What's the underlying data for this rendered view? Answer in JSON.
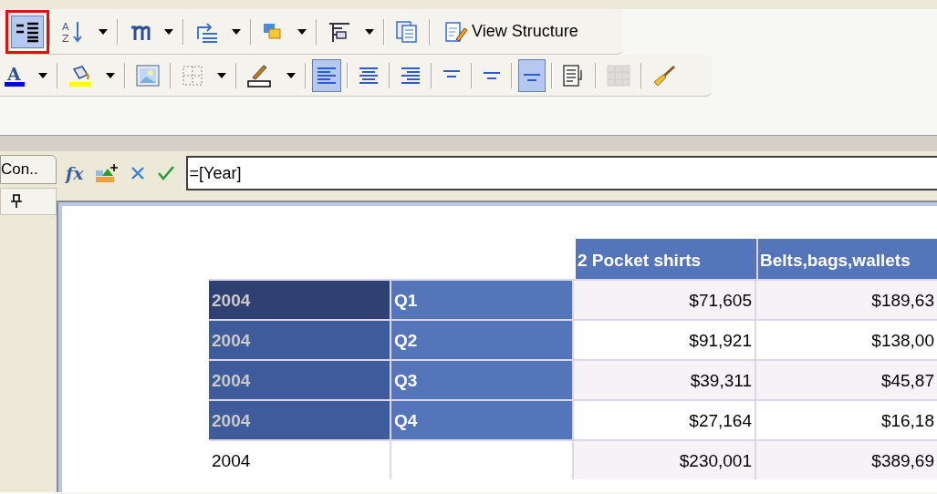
{
  "toolbars": [
    {
      "items": [
        {
          "selected": true,
          "highlighted": true,
          "dropdown": false
        },
        {
          "selected": false,
          "dropdown": true,
          "glyphs": [
            "A",
            "Z"
          ]
        },
        {
          "selected": false,
          "dropdown": true
        },
        {
          "selected": false,
          "dropdown": true
        },
        {
          "selected": false,
          "dropdown": true
        },
        {
          "selected": false,
          "dropdown": true
        },
        {
          "selected": false,
          "dropdown": false
        },
        {
          "selected": false,
          "dropdown": false,
          "label": "View Structure"
        }
      ]
    },
    {
      "items": [
        {
          "selected": false,
          "dropdown": true,
          "glyphs": [
            "A"
          ]
        },
        {
          "selected": false,
          "dropdown": true
        },
        {
          "selected": false,
          "dropdown": false
        },
        {
          "selected": false,
          "dropdown": true
        },
        {
          "selected": false,
          "dropdown": true
        },
        {
          "selected": true,
          "dropdown": false
        },
        {
          "selected": false,
          "dropdown": false
        },
        {
          "selected": false,
          "dropdown": false
        },
        {
          "selected": false,
          "dropdown": false
        },
        {
          "selected": false,
          "dropdown": false
        },
        {
          "selected": true,
          "dropdown": false
        },
        {
          "selected": false,
          "dropdown": false
        },
        {
          "selected": false,
          "dropdown": false,
          "disabled": true
        },
        {
          "selected": false,
          "dropdown": false
        }
      ]
    }
  ],
  "side_panel": {
    "tab": "Con.."
  },
  "formula_bar": {
    "function_label": "fx",
    "value": "=[Year]"
  },
  "table": {
    "columns": [
      "2 Pocket shirts",
      "Belts,bags,wallets"
    ],
    "rows": [
      {
        "kind": "quarter",
        "selected": true,
        "year": "2004",
        "quarter": "Q1",
        "values": [
          "$71,605",
          "$189,63"
        ]
      },
      {
        "kind": "quarter",
        "selected": false,
        "year": "2004",
        "quarter": "Q2",
        "values": [
          "$91,921",
          "$138,00"
        ]
      },
      {
        "kind": "quarter",
        "selected": false,
        "year": "2004",
        "quarter": "Q3",
        "values": [
          "$39,311",
          "$45,87"
        ]
      },
      {
        "kind": "quarter",
        "selected": false,
        "year": "2004",
        "quarter": "Q4",
        "values": [
          "$27,164",
          "$16,18"
        ]
      },
      {
        "kind": "total",
        "year": "2004",
        "values": [
          "$230,001",
          "$389,69"
        ]
      }
    ]
  }
}
